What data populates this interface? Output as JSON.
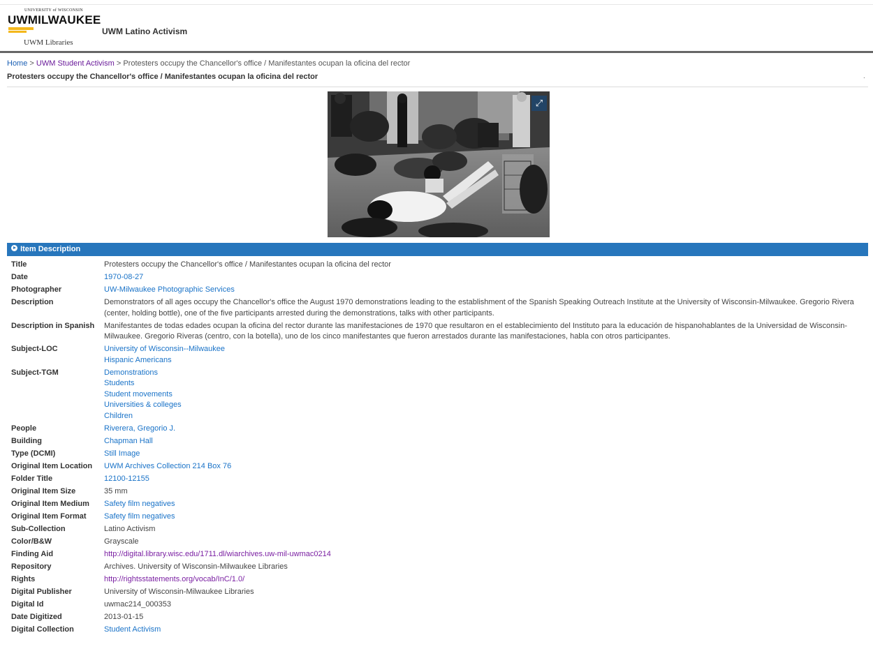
{
  "header": {
    "logo_top": "UNIVERSITY of WISCONSIN",
    "logo_uwm": "UWMILWAUKEE",
    "logo_libraries": "UWM Libraries",
    "site_title": "UWM Latino Activism"
  },
  "breadcrumb": {
    "home": "Home",
    "sep1": ">",
    "collection": "UWM Student Activism",
    "sep2": ">",
    "current": "Protesters occupy the Chancellor's office / Manifestantes ocupan la oficina del rector"
  },
  "page_title": "Protesters occupy the Chancellor's office / Manifestantes ocupan la oficina del rector",
  "title_dot": ".",
  "image": {
    "expand_icon": "expand-arrows-icon"
  },
  "section": {
    "label": "Item Description"
  },
  "fields": [
    {
      "label": "Title",
      "values": [
        {
          "text": "Protesters occupy the Chancellor's office / Manifestantes ocupan la oficina del rector",
          "link": false
        }
      ]
    },
    {
      "label": "Date",
      "values": [
        {
          "text": "1970-08-27",
          "link": true
        }
      ]
    },
    {
      "label": "Photographer",
      "values": [
        {
          "text": "UW-Milwaukee Photographic Services",
          "link": true
        }
      ]
    },
    {
      "label": "Description",
      "values": [
        {
          "text": "Demonstrators of all ages occupy the  Chancellor's office the August 1970 demonstrations leading to the establishment of the Spanish Speaking Outreach Institute at the University of Wisconsin-Milwaukee. Gregorio Rivera (center, holding bottle), one of the five participants arrested during the demonstrations, talks with other participants.",
          "link": false
        }
      ]
    },
    {
      "label": "Description in Spanish",
      "values": [
        {
          "text": "Manifestantes de todas edades ocupan la oficina del rector durante las manifestaciones de 1970 que resultaron en el establecimiento del Instituto para la educación de hispanohablantes de la Universidad de Wisconsin-Milwaukee. Gregorio Riveras (centro, con la botella), uno de los cinco manifestantes que fueron arrestados durante las manifestaciones, habla con otros participantes.",
          "link": false
        }
      ]
    },
    {
      "label": "Subject-LOC",
      "values": [
        {
          "text": "University of Wisconsin--Milwaukee",
          "link": true
        },
        {
          "text": "Hispanic Americans",
          "link": true
        }
      ]
    },
    {
      "label": "Subject-TGM",
      "values": [
        {
          "text": "Demonstrations",
          "link": true
        },
        {
          "text": "Students",
          "link": true
        },
        {
          "text": "Student movements",
          "link": true
        },
        {
          "text": "Universities & colleges",
          "link": true
        },
        {
          "text": "Children",
          "link": true
        }
      ]
    },
    {
      "label": "People",
      "values": [
        {
          "text": "Riverera, Gregorio J.",
          "link": true
        }
      ]
    },
    {
      "label": "Building",
      "values": [
        {
          "text": "Chapman Hall",
          "link": true
        }
      ]
    },
    {
      "label": "Type (DCMI)",
      "values": [
        {
          "text": "Still Image",
          "link": true
        }
      ]
    },
    {
      "label": "Original Item Location",
      "values": [
        {
          "text": "UWM Archives Collection 214 Box 76",
          "link": true
        }
      ]
    },
    {
      "label": "Folder Title",
      "values": [
        {
          "text": "12100-12155",
          "link": true
        }
      ]
    },
    {
      "label": "Original Item Size",
      "values": [
        {
          "text": "35 mm",
          "link": false
        }
      ]
    },
    {
      "label": "Original Item Medium",
      "values": [
        {
          "text": "Safety film negatives",
          "link": true
        }
      ]
    },
    {
      "label": "Original Item Format",
      "values": [
        {
          "text": "Safety film negatives",
          "link": true
        }
      ]
    },
    {
      "label": "Sub-Collection",
      "values": [
        {
          "text": "Latino Activism",
          "link": false
        }
      ]
    },
    {
      "label": "Color/B&W",
      "values": [
        {
          "text": "Grayscale",
          "link": false
        }
      ]
    },
    {
      "label": "Finding Aid",
      "values": [
        {
          "text": "http://digital.library.wisc.edu/1711.dl/wiarchives.uw-mil-uwmac0214",
          "link": true,
          "visited": true
        }
      ]
    },
    {
      "label": "Repository",
      "values": [
        {
          "text": "Archives. University of Wisconsin-Milwaukee Libraries",
          "link": false
        }
      ]
    },
    {
      "label": "Rights",
      "values": [
        {
          "text": "http://rightsstatements.org/vocab/InC/1.0/",
          "link": true,
          "visited": true
        }
      ]
    },
    {
      "label": "Digital Publisher",
      "values": [
        {
          "text": "University of Wisconsin-Milwaukee Libraries",
          "link": false
        }
      ]
    },
    {
      "label": "Digital Id",
      "values": [
        {
          "text": "uwmac214_000353",
          "link": false
        }
      ]
    },
    {
      "label": "Date Digitized",
      "values": [
        {
          "text": "2013-01-15",
          "link": false
        }
      ]
    },
    {
      "label": "Digital Collection",
      "values": [
        {
          "text": "Student Activism",
          "link": true
        }
      ]
    }
  ]
}
